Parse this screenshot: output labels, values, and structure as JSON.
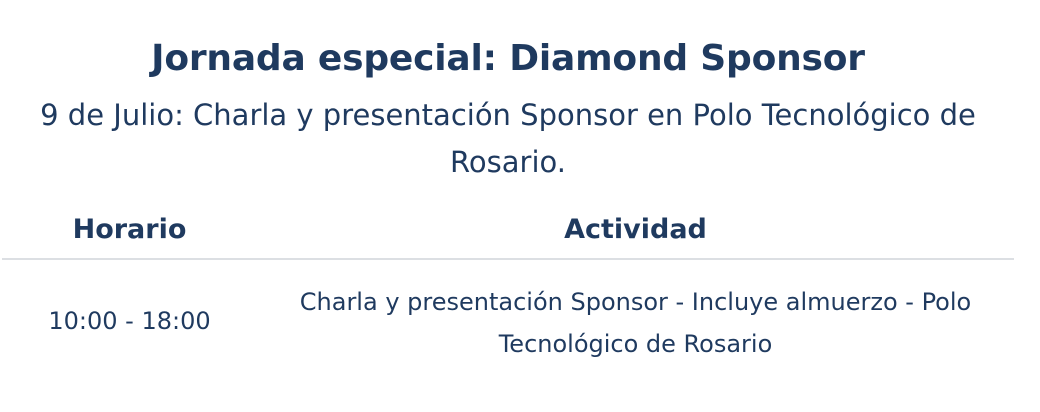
{
  "heading": {
    "title": "Jornada especial: Diamond Sponsor",
    "subtitle": "9 de Julio: Charla y presentación Sponsor en Polo Tecnológico de Rosario."
  },
  "table": {
    "headers": {
      "horario": "Horario",
      "actividad": "Actividad"
    },
    "rows": [
      {
        "horario": "10:00 - 18:00",
        "actividad": "Charla y presentación Sponsor - Incluye almuerzo - Polo Tecnológico de Rosario"
      }
    ]
  },
  "colors": {
    "text": "#1f3a5f",
    "divider": "#dcdfe3",
    "background": "#ffffff"
  }
}
